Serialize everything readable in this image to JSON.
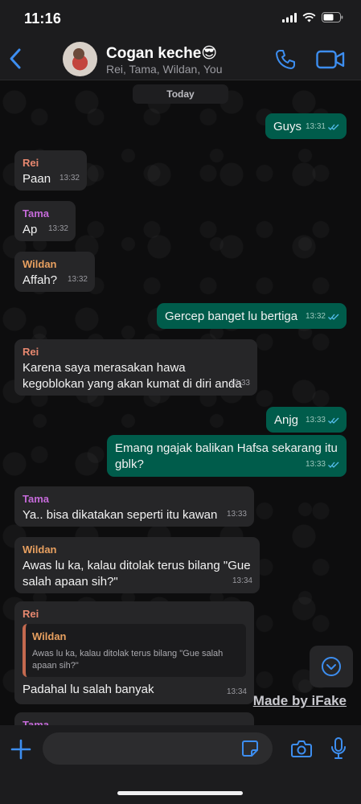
{
  "status_bar": {
    "time": "11:16"
  },
  "header": {
    "title": "Cogan keche😎",
    "members": "Rei, Tama, Wildan, You"
  },
  "chat": {
    "date_label": "Today",
    "messages": [
      {
        "direction": "out",
        "text": "Guys",
        "time": "13:31",
        "read": true
      },
      {
        "direction": "in",
        "sender": "Rei",
        "text": "Paan",
        "time": "13:32"
      },
      {
        "direction": "in",
        "sender": "Tama",
        "text": "Ap",
        "time": "13:32"
      },
      {
        "direction": "in",
        "sender": "Wildan",
        "text": "Affah?",
        "time": "13:32"
      },
      {
        "direction": "out",
        "text": "Gercep banget lu bertiga",
        "time": "13:32",
        "read": true
      },
      {
        "direction": "in",
        "sender": "Rei",
        "text": "Karena saya merasakan hawa kegoblokan yang akan kumat di diri anda",
        "time": "13:33"
      },
      {
        "direction": "out",
        "text": "Anjg",
        "time": "13:33",
        "read": true
      },
      {
        "direction": "out",
        "text": "Emang ngajak balikan Hafsa sekarang itu gblk?",
        "time": "13:33",
        "read": true
      },
      {
        "direction": "in",
        "sender": "Tama",
        "text": "Ya.. bisa dikatakan seperti itu kawan",
        "time": "13:33"
      },
      {
        "direction": "in",
        "sender": "Wildan",
        "text": "Awas lu ka, kalau ditolak terus bilang \"Gue salah apaan sih?\"",
        "time": "13:34"
      },
      {
        "direction": "in",
        "sender": "Rei",
        "quote_sender": "Wildan",
        "quote_text": "Awas lu ka, kalau ditolak terus bilang \"Gue salah apaan sih?\"",
        "text": "Padahal lu salah banyak",
        "time": "13:34"
      },
      {
        "direction": "in",
        "sender": "Tama"
      }
    ]
  },
  "watermark": "Made by iFake",
  "input": {
    "placeholder": ""
  },
  "colors": {
    "outgoing_bubble": "#005c4b",
    "incoming_bubble": "#262628",
    "accent": "#3d8ef0",
    "sender_rei": "#e8886f",
    "sender_tama": "#c46ad8",
    "sender_wildan": "#e8a060"
  }
}
